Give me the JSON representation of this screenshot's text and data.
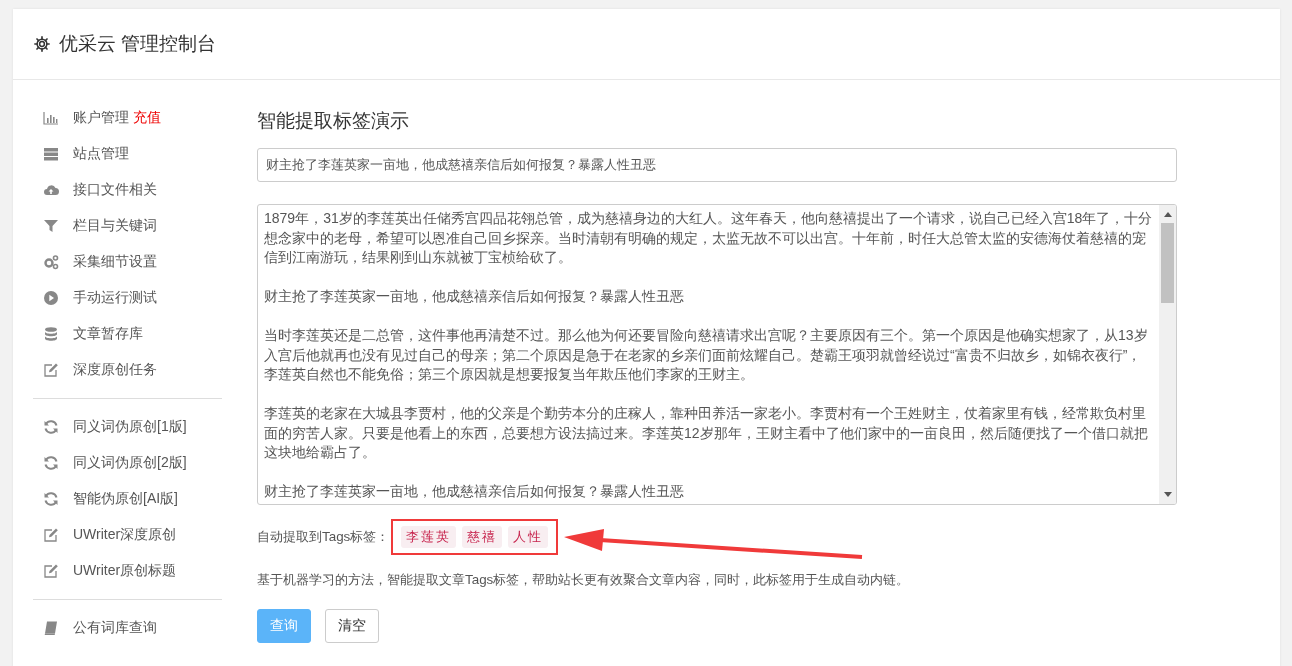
{
  "header": {
    "title": "优采云 管理控制台"
  },
  "sidebar": {
    "groups": [
      [
        {
          "label": "账户管理",
          "badge": "充值"
        },
        {
          "label": "站点管理"
        },
        {
          "label": "接口文件相关"
        },
        {
          "label": "栏目与关键词"
        },
        {
          "label": "采集细节设置"
        },
        {
          "label": "手动运行测试"
        },
        {
          "label": "文章暂存库"
        },
        {
          "label": "深度原创任务"
        }
      ],
      [
        {
          "label": "同义词伪原创[1版]"
        },
        {
          "label": "同义词伪原创[2版]"
        },
        {
          "label": "智能伪原创[AI版]"
        },
        {
          "label": "UWriter深度原创"
        },
        {
          "label": "UWriter原创标题"
        }
      ],
      [
        {
          "label": "公有词库查询"
        }
      ]
    ]
  },
  "content": {
    "heading": "智能提取标签演示",
    "title_field": {
      "value": "财主抢了李莲英家一亩地，他成慈禧亲信后如何报复？暴露人性丑恶"
    },
    "article": [
      "1879年，31岁的李莲英出任储秀宫四品花翎总管，成为慈禧身边的大红人。这年春天，他向慈禧提出了一个请求，说自己已经入宫18年了，十分想念家中的老母，希望可以恩准自己回乡探亲。当时清朝有明确的规定，太监无故不可以出宫。十年前，时任大总管太监的安德海仗着慈禧的宠信到江南游玩，结果刚到山东就被丁宝桢给砍了。",
      "财主抢了李莲英家一亩地，他成慈禧亲信后如何报复？暴露人性丑恶",
      "当时李莲英还是二总管，这件事他再清楚不过。那么他为何还要冒险向慈禧请求出宫呢？主要原因有三个。第一个原因是他确实想家了，从13岁入宫后他就再也没有见过自己的母亲；第二个原因是急于在老家的乡亲们面前炫耀自己。楚霸王项羽就曾经说过“富贵不归故乡，如锦衣夜行”，李莲英自然也不能免俗；第三个原因就是想要报复当年欺压他们李家的王财主。",
      "李莲英的老家在大城县李贾村，他的父亲是个勤劳本分的庄稼人，靠种田养活一家老小。李贾村有一个王姓财主，仗着家里有钱，经常欺负村里面的穷苦人家。只要是他看上的东西，总要想方设法搞过来。李莲英12岁那年，王财主看中了他们家中的一亩良田，然后随便找了一个借口就把这块地给霸占了。",
      "财主抢了李莲英家一亩地，他成慈禧亲信后如何报复？暴露人性丑恶"
    ],
    "tags_label": "自动提取到Tags标签：",
    "tags": [
      "李莲英",
      "慈禧",
      "人性"
    ],
    "description": "基于机器学习的方法，智能提取文章Tags标签，帮助站长更有效聚合文章内容，同时，此标签用于生成自动内链。",
    "buttons": [
      {
        "label": "查询",
        "kind": "primary"
      },
      {
        "label": "清空",
        "kind": "default"
      }
    ]
  }
}
